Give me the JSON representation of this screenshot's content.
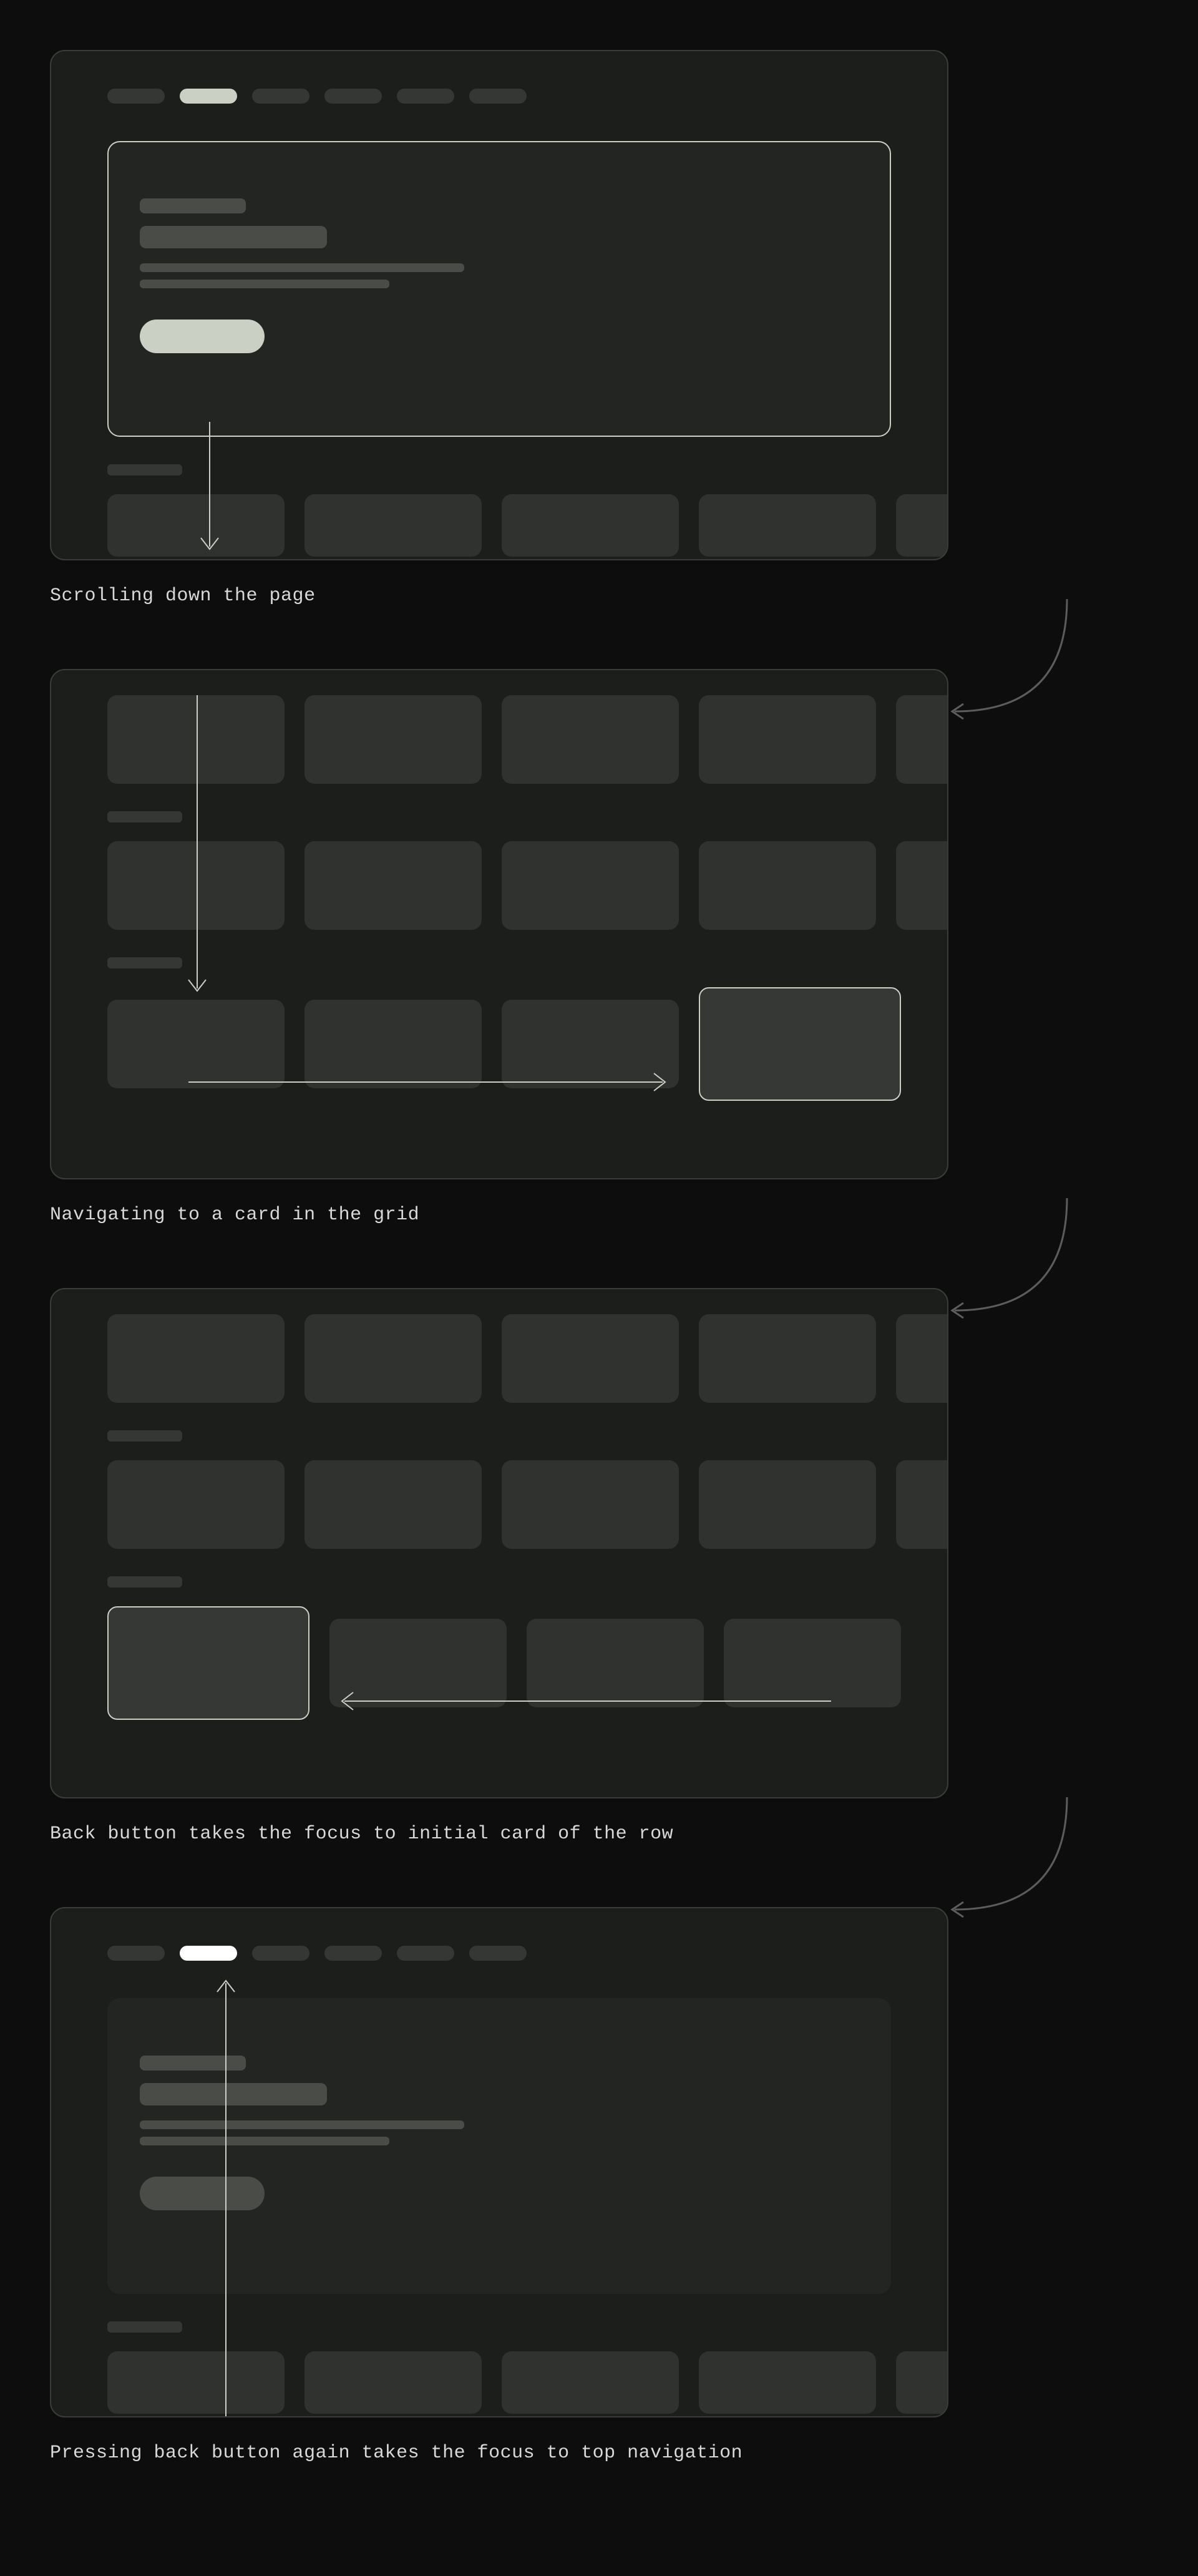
{
  "steps": [
    {
      "caption": "Scrolling down the page"
    },
    {
      "caption": "Navigating to a card in the grid"
    },
    {
      "caption": "Back button takes the focus to initial card of the row"
    },
    {
      "caption": "Pressing back button again takes the focus to top navigation"
    }
  ],
  "remote": {
    "power": "⏻",
    "mic": "🎤",
    "back": "←",
    "home": "⌂"
  }
}
